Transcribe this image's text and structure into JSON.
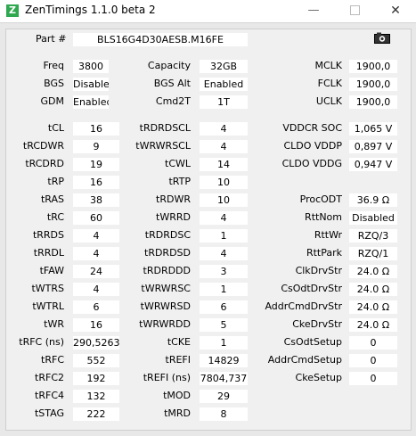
{
  "window": {
    "title": "ZenTimings 1.1.0 beta 2",
    "icon_letter": "Z"
  },
  "part": {
    "label": "Part #",
    "value": "BLS16G4D30AESB.M16FE"
  },
  "top": [
    [
      {
        "label": "Freq",
        "value": "3800"
      },
      {
        "label": "Capacity",
        "value": "32GB"
      },
      {
        "label": "MCLK",
        "value": "1900,0"
      }
    ],
    [
      {
        "label": "BGS",
        "value": "Disabled"
      },
      {
        "label": "BGS Alt",
        "value": "Enabled"
      },
      {
        "label": "FCLK",
        "value": "1900,0"
      }
    ],
    [
      {
        "label": "GDM",
        "value": "Enabled"
      },
      {
        "label": "Cmd2T",
        "value": "1T"
      },
      {
        "label": "UCLK",
        "value": "1900,0"
      }
    ]
  ],
  "col1": [
    {
      "label": "tCL",
      "value": "16"
    },
    {
      "label": "tRCDWR",
      "value": "9"
    },
    {
      "label": "tRCDRD",
      "value": "19"
    },
    {
      "label": "tRP",
      "value": "16"
    },
    {
      "label": "tRAS",
      "value": "38"
    },
    {
      "label": "tRC",
      "value": "60"
    },
    {
      "label": "tRRDS",
      "value": "4"
    },
    {
      "label": "tRRDL",
      "value": "4"
    },
    {
      "label": "tFAW",
      "value": "24"
    },
    {
      "label": "tWTRS",
      "value": "4"
    },
    {
      "label": "tWTRL",
      "value": "6"
    },
    {
      "label": "tWR",
      "value": "16"
    },
    {
      "label": "tRFC (ns)",
      "value": "290,5263"
    },
    {
      "label": "tRFC",
      "value": "552"
    },
    {
      "label": "tRFC2",
      "value": "192"
    },
    {
      "label": "tRFC4",
      "value": "132"
    },
    {
      "label": "tSTAG",
      "value": "222"
    }
  ],
  "col2": [
    {
      "label": "tRDRDSCL",
      "value": "4"
    },
    {
      "label": "tWRWRSCL",
      "value": "4"
    },
    {
      "label": "tCWL",
      "value": "14"
    },
    {
      "label": "tRTP",
      "value": "10"
    },
    {
      "label": "tRDWR",
      "value": "10"
    },
    {
      "label": "tWRRD",
      "value": "4"
    },
    {
      "label": "tRDRDSC",
      "value": "1"
    },
    {
      "label": "tRDRDSD",
      "value": "4"
    },
    {
      "label": "tRDRDDD",
      "value": "3"
    },
    {
      "label": "tWRWRSC",
      "value": "1"
    },
    {
      "label": "tWRWRSD",
      "value": "6"
    },
    {
      "label": "tWRWRDD",
      "value": "5"
    },
    {
      "label": "tCKE",
      "value": "1"
    },
    {
      "label": "tREFI",
      "value": "14829"
    },
    {
      "label": "tREFI (ns)",
      "value": "7804,737"
    },
    {
      "label": "tMOD",
      "value": "29"
    },
    {
      "label": "tMRD",
      "value": "8"
    }
  ],
  "col3": [
    {
      "label": "VDDCR SOC",
      "value": "1,065 V"
    },
    {
      "label": "CLDO VDDP",
      "value": "0,897 V"
    },
    {
      "label": "CLDO VDDG",
      "value": "0,947 V"
    },
    null,
    {
      "label": "ProcODT",
      "value": "36.9 Ω"
    },
    {
      "label": "RttNom",
      "value": "Disabled"
    },
    {
      "label": "RttWr",
      "value": "RZQ/3"
    },
    {
      "label": "RttPark",
      "value": "RZQ/1"
    },
    {
      "label": "ClkDrvStr",
      "value": "24.0 Ω"
    },
    {
      "label": "CsOdtDrvStr",
      "value": "24.0 Ω"
    },
    {
      "label": "AddrCmdDrvStr",
      "value": "24.0 Ω"
    },
    {
      "label": "CkeDrvStr",
      "value": "24.0 Ω"
    },
    {
      "label": "CsOdtSetup",
      "value": "0"
    },
    {
      "label": "AddrCmdSetup",
      "value": "0"
    },
    {
      "label": "CkeSetup",
      "value": "0"
    }
  ]
}
